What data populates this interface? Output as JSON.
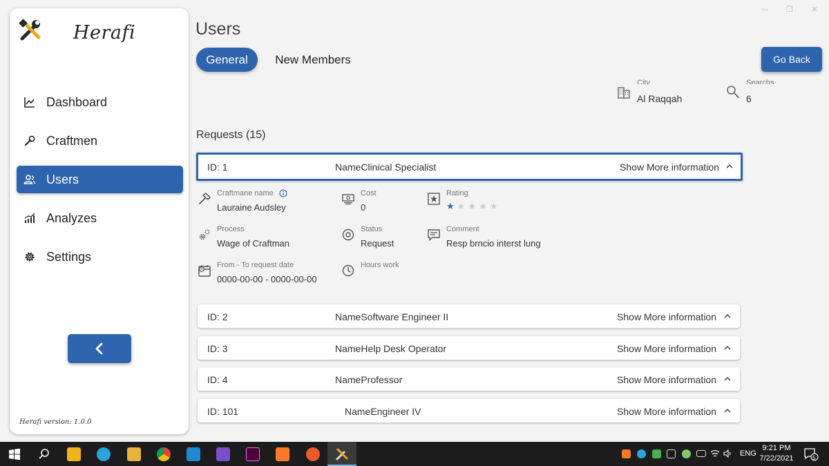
{
  "window": {
    "minimize": "—",
    "maximize": "❐",
    "close": "✕"
  },
  "sidebar": {
    "brand": "Herafi",
    "items": [
      {
        "label": "Dashboard",
        "icon": "chart-line-icon",
        "active": false
      },
      {
        "label": "Craftmen",
        "icon": "wrench-icon",
        "active": false
      },
      {
        "label": "Users",
        "icon": "users-icon",
        "active": true
      },
      {
        "label": "Analyzes",
        "icon": "analytics-icon",
        "active": false
      },
      {
        "label": "Settings",
        "icon": "gear-icon",
        "active": false
      }
    ],
    "version": "Herafi version: 1.0.0"
  },
  "page": {
    "title": "Users",
    "tabs": [
      {
        "label": "General",
        "active": true
      },
      {
        "label": "New Members",
        "active": false
      }
    ],
    "go_back": "Go Back",
    "city": {
      "label": "City",
      "value": "Al Raqqah"
    },
    "searches": {
      "label": "Searchs",
      "value": "6"
    }
  },
  "requests": {
    "title": "Requests (15)",
    "show_more": "Show More information",
    "items": [
      {
        "id": "ID: 1",
        "name": "NameClinical Specialist",
        "expanded": true
      },
      {
        "id": "ID: 2",
        "name": "NameSoftware Engineer II",
        "expanded": false
      },
      {
        "id": "ID: 3",
        "name": "NameHelp Desk Operator",
        "expanded": false
      },
      {
        "id": "ID: 4",
        "name": "NameProfessor",
        "expanded": false
      },
      {
        "id": "ID: 101",
        "name": "NameEngineer IV",
        "expanded": false
      }
    ],
    "detail": {
      "craftman_label": "Craftmane name",
      "craftman_value": "Lauraine Audsley",
      "cost_label": "Cost",
      "cost_value": "0",
      "rating_label": "Rating",
      "rating_value": 1,
      "rating_max": 5,
      "process_label": "Process",
      "process_value": "Wage of Craftman",
      "status_label": "Status",
      "status_value": "Request",
      "comment_label": "Comment",
      "comment_value": "Resp brncio interst lung",
      "date_label": "From - To request date",
      "date_value": "0000-00-00 - 0000-00-00",
      "hours_label": "Hours work"
    }
  },
  "taskbar": {
    "lang": "ENG",
    "time": "9:21 PM",
    "date": "7/22/2021",
    "notifications": "5"
  }
}
